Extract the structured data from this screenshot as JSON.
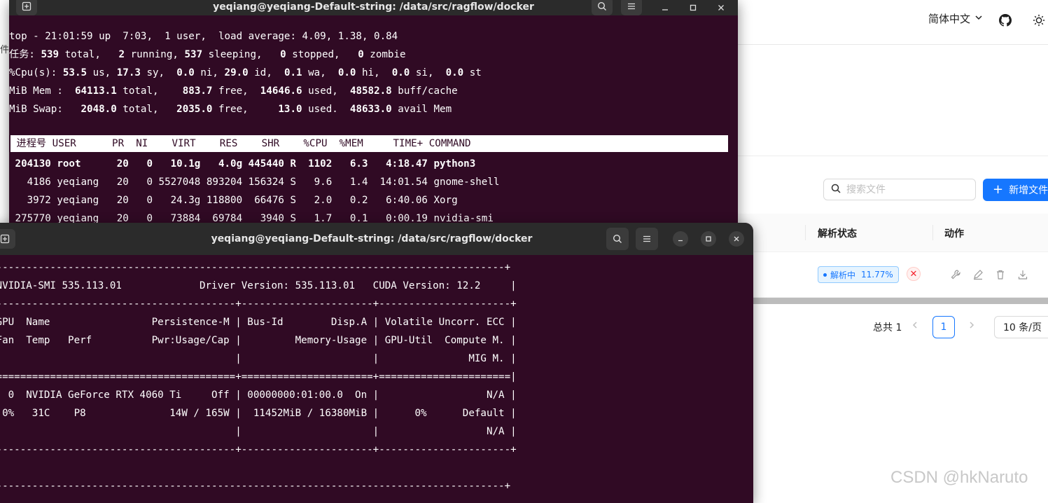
{
  "web": {
    "language": "简体中文",
    "side_char": "件",
    "search_placeholder": "搜索文件",
    "add_button": "新增文件",
    "col_parse_status": "解析状态",
    "col_action": "动作",
    "status_label": "解析中",
    "status_progress": "11.77%",
    "status_progress_value": 0.1177,
    "cancel_icon": "✕",
    "total": "总共 1",
    "page": "1",
    "page_size": "10 条/页",
    "watermark": "CSDN @hkNaruto"
  },
  "term1": {
    "title": "yeqiang@yeqiang-Default-string: /data/src/ragflow/docker",
    "l1": "top - 21:01:59 up  7:03,  1 user,  load average: 4.09, 1.38, 0.84",
    "l2a": "任务: ",
    "l2b": "539",
    "l2c": " total,   ",
    "l2d": "2",
    "l2e": " running, ",
    "l2f": "537",
    "l2g": " sleeping,   ",
    "l2h": "0",
    "l2i": " stopped,   ",
    "l2j": "0",
    "l2k": " zombie",
    "l3a": "%Cpu(s): ",
    "l3b": "53.5",
    "l3c": " us, ",
    "l3d": "17.3",
    "l3e": " sy,  ",
    "l3f": "0.0",
    "l3g": " ni, ",
    "l3h": "29.0",
    "l3i": " id,  ",
    "l3j": "0.1",
    "l3k": " wa,  ",
    "l3l": "0.0",
    "l3m": " hi,  ",
    "l3n": "0.0",
    "l3o": " si,  ",
    "l3p": "0.0",
    "l3q": " st",
    "l4a": "MiB Mem :  ",
    "l4b": "64113.1",
    "l4c": " total,    ",
    "l4d": "883.7",
    "l4e": " free,  ",
    "l4f": "14646.6",
    "l4g": " used,  ",
    "l4h": "48582.8",
    "l4i": " buff/cache",
    "l5a": "MiB Swap:   ",
    "l5b": "2048.0",
    "l5c": " total,   ",
    "l5d": "2035.0",
    "l5e": " free,     ",
    "l5f": "13.0",
    "l5g": " used.  ",
    "l5h": "48633.0",
    "l5i": " avail Mem",
    "header": " 进程号 USER      PR  NI    VIRT    RES    SHR    %CPU  %MEM     TIME+ COMMAND                                      ",
    "p1": " 204130 root      20   0   10.1g   4.0g 445440 R  1102   6.3   4:18.47 python3",
    "p2": "   4186 yeqiang   20   0 5527048 893204 156324 S   9.6   1.4  14:01.54 gnome-shell",
    "p3": "   3972 yeqiang   20   0   24.3g 118800  66476 S   2.0   0.2   6:40.06 Xorg",
    "p4": " 275770 yeqiang   20   0   73884  69784   3940 S   1.7   0.1   0:00.19 nvidia-smi"
  },
  "term2": {
    "title": "yeqiang@yeqiang-Default-string: /data/src/ragflow/docker",
    "l1": "--------------------------------------------------------------------------------------+",
    "l2": " NVIDIA-SMI 535.113.01             Driver Version: 535.113.01   CUDA Version: 12.2     |",
    "l3": "-----------------------------------------+----------------------+----------------------+",
    "l4": " GPU  Name                 Persistence-M | Bus-Id        Disp.A | Volatile Uncorr. ECC |",
    "l5": " Fan  Temp   Perf          Pwr:Usage/Cap |         Memory-Usage | GPU-Util  Compute M. |",
    "l6": "                                         |                      |               MIG M. |",
    "l7": "=========================================+======================+======================|",
    "l8": "   0  NVIDIA GeForce RTX 4060 Ti     Off | 00000000:01:00.0  On |                  N/A |",
    "l9": "  0%   31C    P8              14W / 165W |  11452MiB / 16380MiB |      0%      Default |",
    "l10": "                                         |                      |                  N/A |",
    "l11": "-----------------------------------------+----------------------+----------------------+",
    "l12": "",
    "l13": "--------------------------------------------------------------------------------------+"
  }
}
